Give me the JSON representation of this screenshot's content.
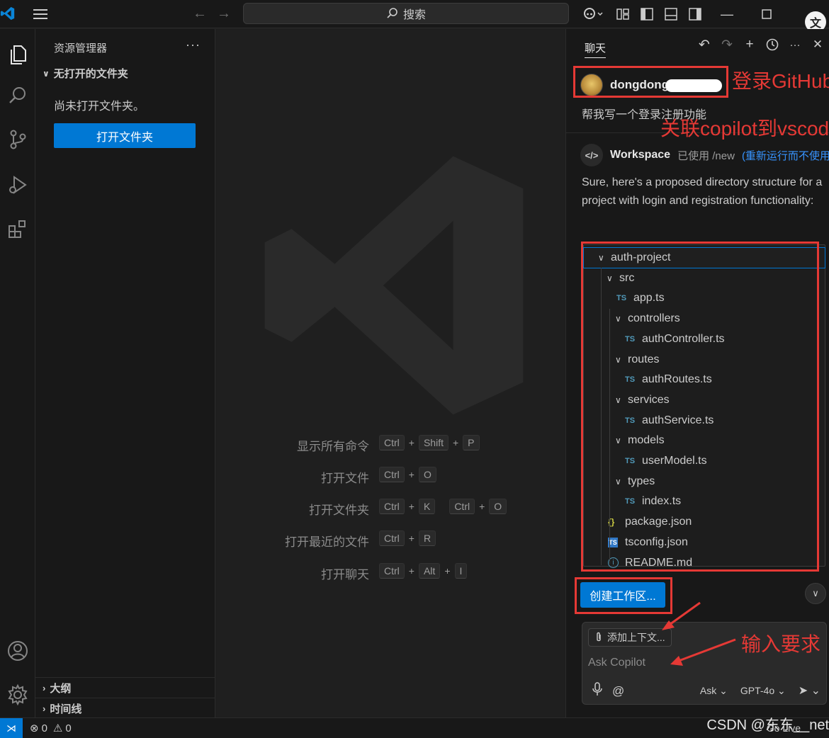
{
  "titlebar": {
    "search_label": "搜索"
  },
  "sidebar": {
    "header": "资源管理器",
    "more": "···",
    "section": "无打开的文件夹",
    "empty_text": "尚未打开文件夹。",
    "open_folder_button": "打开文件夹",
    "outline": "大纲",
    "timeline": "时间线"
  },
  "editor": {
    "shortcuts": [
      {
        "label": "显示所有命令",
        "keys": [
          "Ctrl",
          "Shift",
          "P"
        ]
      },
      {
        "label": "打开文件",
        "keys": [
          "Ctrl",
          "O"
        ]
      },
      {
        "label": "打开文件夹",
        "keys": [
          "Ctrl",
          "K"
        ],
        "keys2": [
          "Ctrl",
          "O"
        ]
      },
      {
        "label": "打开最近的文件",
        "keys": [
          "Ctrl",
          "R"
        ]
      },
      {
        "label": "打开聊天",
        "keys": [
          "Ctrl",
          "Alt",
          "I"
        ]
      }
    ]
  },
  "chat": {
    "tab": "聊天",
    "user": {
      "name": "dongdong",
      "message": "帮我写一个登录注册功能"
    },
    "agent": {
      "name": "Workspace",
      "used": "已使用 /new",
      "link": "(重新运行而不使用"
    },
    "response": "Sure, here's a proposed directory structure for a project with login and registration functionality:",
    "tree": [
      {
        "name": "auth-project",
        "kind": "folder",
        "indent": 0
      },
      {
        "name": "src",
        "kind": "folder",
        "indent": 1
      },
      {
        "name": "app.ts",
        "kind": "ts",
        "indent": 2
      },
      {
        "name": "controllers",
        "kind": "folder",
        "indent": 2
      },
      {
        "name": "authController.ts",
        "kind": "ts",
        "indent": 3
      },
      {
        "name": "routes",
        "kind": "folder",
        "indent": 2
      },
      {
        "name": "authRoutes.ts",
        "kind": "ts",
        "indent": 3
      },
      {
        "name": "services",
        "kind": "folder",
        "indent": 2
      },
      {
        "name": "authService.ts",
        "kind": "ts",
        "indent": 3
      },
      {
        "name": "models",
        "kind": "folder",
        "indent": 2
      },
      {
        "name": "userModel.ts",
        "kind": "ts",
        "indent": 3
      },
      {
        "name": "types",
        "kind": "folder",
        "indent": 2
      },
      {
        "name": "index.ts",
        "kind": "ts",
        "indent": 3
      },
      {
        "name": "package.json",
        "kind": "json",
        "indent": 1
      },
      {
        "name": "tsconfig.json",
        "kind": "tsconfig",
        "indent": 1
      },
      {
        "name": "README.md",
        "kind": "info",
        "indent": 1
      }
    ],
    "create_button": "创建工作区...",
    "input": {
      "context_button": "添加上下文...",
      "placeholder": "Ask Copilot",
      "mode": "Ask",
      "model": "GPT-4o"
    }
  },
  "statusbar": {
    "errors": "0",
    "warnings": "0",
    "golive": "Go Live"
  },
  "annotations": {
    "login_github": "登录GitHub",
    "link_copilot": "关联copilot到vscode",
    "input_request": "输入要求"
  },
  "watermark_text": "CSDN @东东__net",
  "colors": {
    "accent": "#0078d4",
    "annotation": "#e53935",
    "link": "#3794ff"
  }
}
